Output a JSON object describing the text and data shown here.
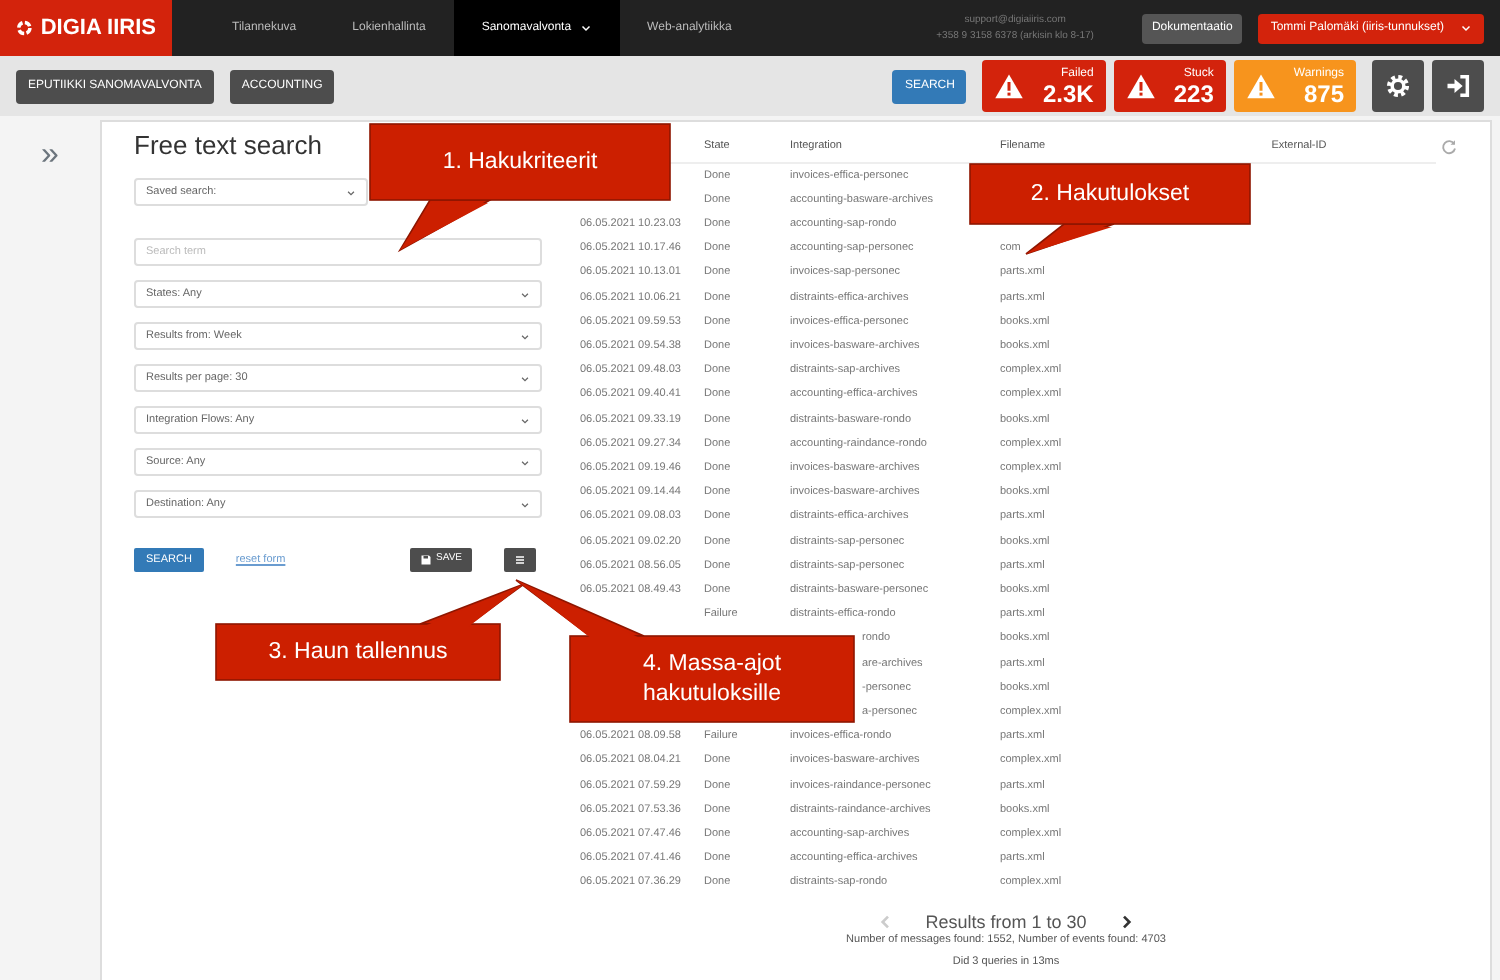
{
  "navbar": {
    "brand": "DIGIA IIRIS",
    "items": [
      {
        "label": "Tilannekuva",
        "selected": false,
        "dropdown": false
      },
      {
        "label": "Lokienhallinta",
        "selected": false,
        "dropdown": false
      },
      {
        "label": "Sanomavalvonta",
        "selected": true,
        "dropdown": true
      },
      {
        "label": "Web-analytiikka",
        "selected": false,
        "dropdown": false
      }
    ],
    "support_email": "support@digiaiiris.com",
    "support_phone": "+358 9 3158 6378 (arkisin klo 8-17)",
    "docs_button": "Dokumentaatio",
    "user_menu": "Tommi Palomäki (iiris-tunnukset)"
  },
  "toolbar": {
    "tabs": [
      "EPUTIIKKI SANOMAVALVONTA",
      "ACCOUNTING"
    ],
    "search_button": "SEARCH",
    "alerts": [
      {
        "label": "Failed",
        "count": "2.3K",
        "color": "#d3230c"
      },
      {
        "label": "Stuck",
        "count": "223",
        "color": "#d3230c"
      },
      {
        "label": "Warnings",
        "count": "875",
        "color": "#f7941d"
      }
    ]
  },
  "sidebar_toggle": "»",
  "search_panel": {
    "title": "Free text search",
    "fields": [
      {
        "kind": "select",
        "text": "Saved search:"
      },
      {
        "kind": "input",
        "placeholder": "Search term"
      },
      {
        "kind": "select",
        "text": "States: Any"
      },
      {
        "kind": "select",
        "text": "Results from: Week"
      },
      {
        "kind": "select",
        "text": "Results per page: 30"
      },
      {
        "kind": "select",
        "text": "Integration Flows: Any"
      },
      {
        "kind": "select",
        "text": "Source: Any"
      },
      {
        "kind": "select",
        "text": "Destination: Any"
      }
    ],
    "search_button": "SEARCH",
    "reset_link": "reset form",
    "save_button": "SAVE"
  },
  "table": {
    "columns": [
      "State",
      "Integration",
      "Filename",
      "External-ID"
    ],
    "rows": [
      {
        "state": "Done",
        "integration": "invoices-effica-personec"
      },
      {
        "state": "Done",
        "integration": "accounting-basware-archives"
      },
      {
        "date": "06.05.2021 10.23.03",
        "state": "Done",
        "integration": "accounting-sap-rondo"
      },
      {
        "date": "06.05.2021 10.17.46",
        "state": "Done",
        "integration": "accounting-sap-personec",
        "filename": "com"
      },
      {
        "date": "06.05.2021 10.13.01",
        "state": "Done",
        "integration": "invoices-sap-personec",
        "filename": "parts.xml"
      },
      {
        "date": "06.05.2021 10.06.21",
        "state": "Done",
        "integration": "distraints-effica-archives",
        "filename": "parts.xml"
      },
      {
        "date": "06.05.2021 09.59.53",
        "state": "Done",
        "integration": "invoices-effica-personec",
        "filename": "books.xml"
      },
      {
        "date": "06.05.2021 09.54.38",
        "state": "Done",
        "integration": "invoices-basware-archives",
        "filename": "books.xml"
      },
      {
        "date": "06.05.2021 09.48.03",
        "state": "Done",
        "integration": "distraints-sap-archives",
        "filename": "complex.xml"
      },
      {
        "date": "06.05.2021 09.40.41",
        "state": "Done",
        "integration": "accounting-effica-archives",
        "filename": "complex.xml"
      },
      {
        "date": "06.05.2021 09.33.19",
        "state": "Done",
        "integration": "distraints-basware-rondo",
        "filename": "books.xml"
      },
      {
        "date": "06.05.2021 09.27.34",
        "state": "Done",
        "integration": "accounting-raindance-rondo",
        "filename": "complex.xml"
      },
      {
        "date": "06.05.2021 09.19.46",
        "state": "Done",
        "integration": "invoices-basware-archives",
        "filename": "complex.xml"
      },
      {
        "date": "06.05.2021 09.14.44",
        "state": "Done",
        "integration": "invoices-basware-archives",
        "filename": "books.xml"
      },
      {
        "date": "06.05.2021 09.08.03",
        "state": "Done",
        "integration": "distraints-effica-archives",
        "filename": "parts.xml"
      },
      {
        "date": "06.05.2021 09.02.20",
        "state": "Done",
        "integration": "distraints-sap-personec",
        "filename": "books.xml"
      },
      {
        "date": "06.05.2021 08.56.05",
        "state": "Done",
        "integration": "distraints-sap-personec",
        "filename": "parts.xml"
      },
      {
        "date": "06.05.2021 08.49.43",
        "state": "Done",
        "integration": "distraints-basware-personec",
        "filename": "books.xml"
      },
      {
        "state": "Failure",
        "integration": "distraints-effica-rondo",
        "filename": "parts.xml"
      },
      {
        "integration": "rondo",
        "filename": "books.xml"
      },
      {
        "integration": "are-archives",
        "filename": "parts.xml"
      },
      {
        "integration": "-personec",
        "filename": "books.xml"
      },
      {
        "integration": "a-personec",
        "filename": "complex.xml"
      },
      {
        "date": "06.05.2021 08.09.58",
        "state": "Failure",
        "integration": "invoices-effica-rondo",
        "filename": "parts.xml"
      },
      {
        "date": "06.05.2021 08.04.21",
        "state": "Done",
        "integration": "invoices-basware-archives",
        "filename": "complex.xml"
      },
      {
        "date": "06.05.2021 07.59.29",
        "state": "Done",
        "integration": "invoices-raindance-personec",
        "filename": "parts.xml"
      },
      {
        "date": "06.05.2021 07.53.36",
        "state": "Done",
        "integration": "distraints-raindance-archives",
        "filename": "books.xml"
      },
      {
        "date": "06.05.2021 07.47.46",
        "state": "Done",
        "integration": "accounting-sap-archives",
        "filename": "complex.xml"
      },
      {
        "date": "06.05.2021 07.41.46",
        "state": "Done",
        "integration": "accounting-effica-archives",
        "filename": "parts.xml"
      },
      {
        "date": "06.05.2021 07.36.29",
        "state": "Done",
        "integration": "distraints-sap-rondo",
        "filename": "complex.xml"
      }
    ]
  },
  "pagination": {
    "label": "Results from 1 to 30",
    "prev_disabled": true,
    "next_disabled": false
  },
  "summary": "Number of messages found: 1552, Number of events found: 4703",
  "timing": "Did 3 queries in 13ms",
  "callouts": [
    {
      "text": "1. Hakukriteerit"
    },
    {
      "text": "2. Hakutulokset"
    },
    {
      "text": "3. Haun tallennus"
    },
    {
      "text": "4. Massa-ajot hakutuloksille"
    }
  ]
}
